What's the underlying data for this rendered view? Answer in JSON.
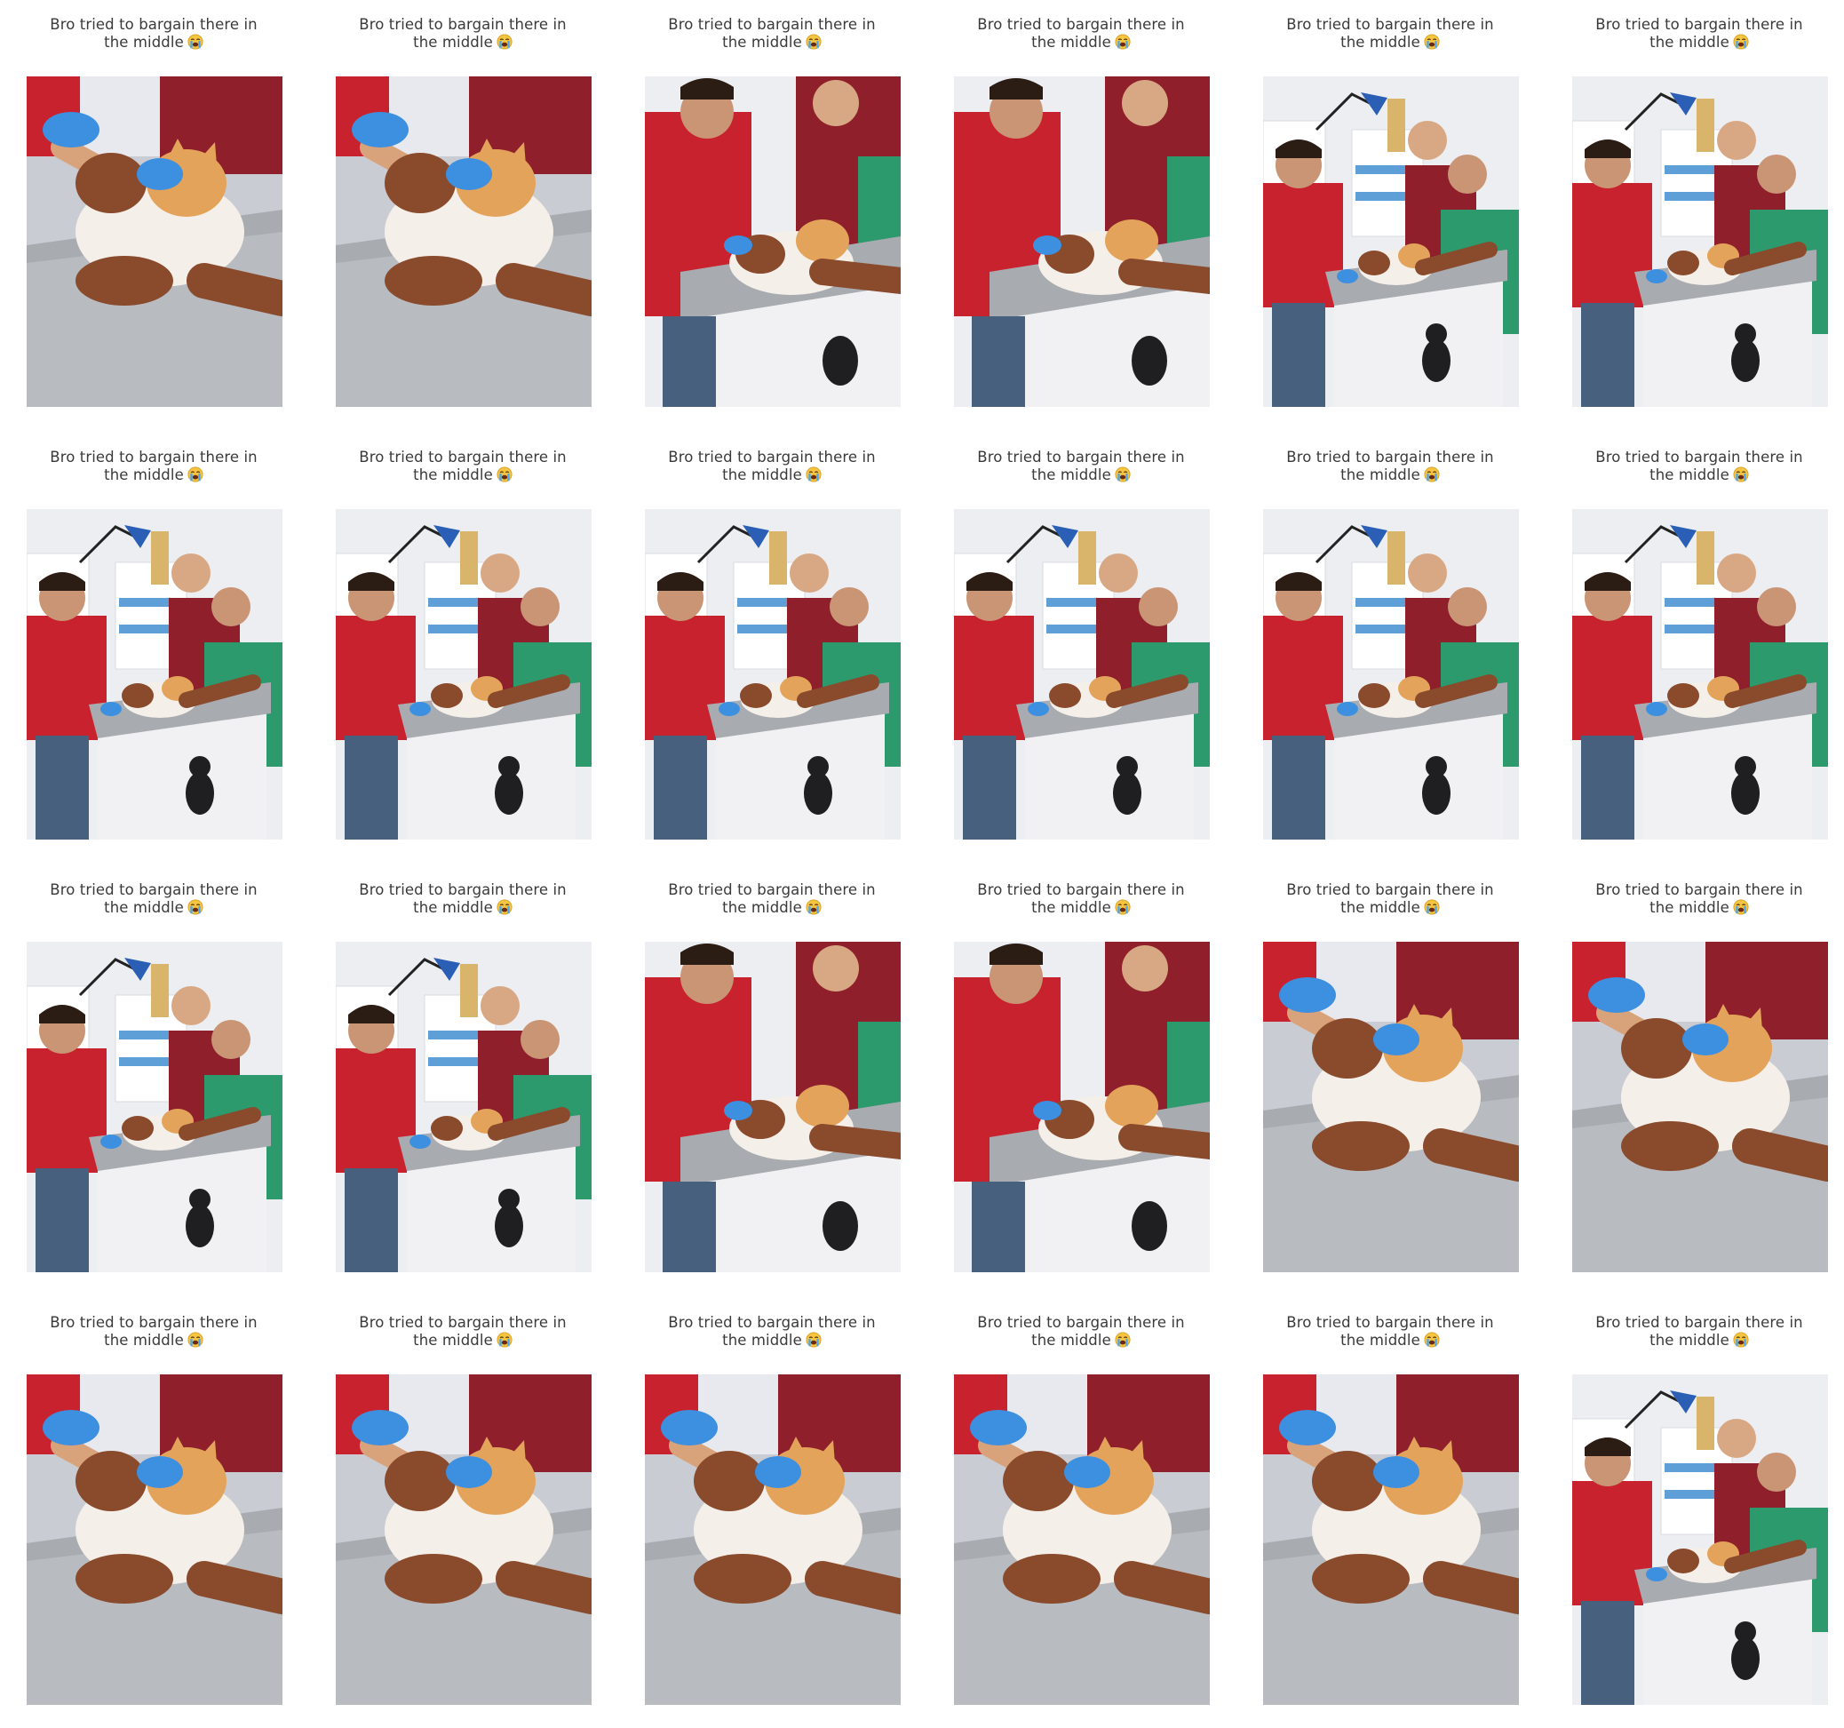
{
  "caption_line1": "Bro tried to bargain there in",
  "caption_line2": "the middle",
  "caption_emoji": "loudly-crying-face-icon",
  "grid": {
    "rows": 4,
    "cols": 6
  },
  "frames": [
    {
      "scene": "closeup"
    },
    {
      "scene": "closeup"
    },
    {
      "scene": "medium"
    },
    {
      "scene": "medium"
    },
    {
      "scene": "wide"
    },
    {
      "scene": "wide"
    },
    {
      "scene": "wide"
    },
    {
      "scene": "wide"
    },
    {
      "scene": "wide"
    },
    {
      "scene": "wide"
    },
    {
      "scene": "wide"
    },
    {
      "scene": "wide"
    },
    {
      "scene": "wide"
    },
    {
      "scene": "wide"
    },
    {
      "scene": "medium"
    },
    {
      "scene": "medium"
    },
    {
      "scene": "closeup"
    },
    {
      "scene": "closeup"
    },
    {
      "scene": "closeup"
    },
    {
      "scene": "closeup"
    },
    {
      "scene": "closeup"
    },
    {
      "scene": "closeup"
    },
    {
      "scene": "closeup"
    },
    {
      "scene": "wide"
    }
  ],
  "colors": {
    "red_shirt": "#c8222e",
    "maroon_scrubs": "#8e1f2b",
    "green_scrubs": "#2c9a6c",
    "glove_blue": "#3d8fe0",
    "table_steel": "#a8abb0",
    "cabinet_white": "#f1f1f3",
    "cat_orange": "#e3a35a",
    "cat_white": "#f4efe8",
    "leather_glove": "#8a4a2c",
    "wall": "#eceef2",
    "caption_text": "#3a3a3a"
  }
}
